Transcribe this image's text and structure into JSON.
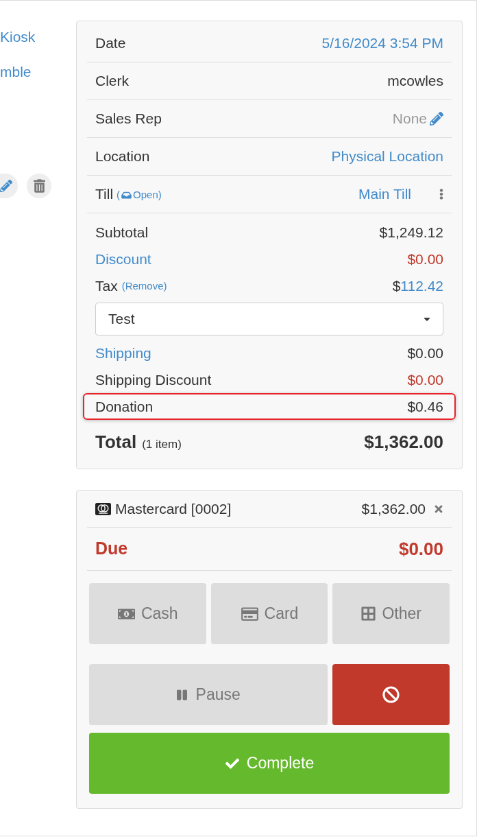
{
  "sidebar": {
    "links": [
      {
        "label": "Kiosk"
      },
      {
        "label": "mble"
      }
    ],
    "actions": [
      {
        "kind": "edit"
      },
      {
        "kind": "delete"
      }
    ]
  },
  "details": [
    {
      "label": "Date",
      "value": "5/16/2024 3:54 PM",
      "kind": "link"
    },
    {
      "label": "Clerk",
      "value": "mcowles",
      "kind": "text"
    },
    {
      "label": "Sales Rep",
      "value": "None",
      "kind": "empty_editable"
    },
    {
      "label": "Location",
      "value": "Physical Location",
      "kind": "link"
    },
    {
      "label": "Till",
      "status": {
        "open": "(",
        "text": "Open",
        "close": ")"
      },
      "value": "Main Till",
      "kind": "till"
    }
  ],
  "summary": {
    "lines": [
      {
        "kind": "line",
        "label": "Subtotal",
        "link": false,
        "deduction": false,
        "highlighted": false,
        "value": "$1,249.12"
      },
      {
        "kind": "line",
        "label": "Discount",
        "link": true,
        "deduction": true,
        "highlighted": false,
        "value": "$0.00"
      },
      {
        "kind": "tax",
        "label": "Tax",
        "action": "(Remove)",
        "currency": "$",
        "value": "112.42"
      },
      {
        "kind": "select",
        "value": "Test"
      },
      {
        "kind": "line",
        "label": "Shipping",
        "link": true,
        "deduction": false,
        "highlighted": false,
        "value": "$0.00"
      },
      {
        "kind": "line",
        "label": "Shipping Discount",
        "link": false,
        "deduction": true,
        "highlighted": false,
        "value": "$0.00"
      },
      {
        "kind": "line",
        "label": "Donation",
        "link": false,
        "deduction": false,
        "highlighted": true,
        "value": "$0.46"
      }
    ],
    "total": {
      "label": "Total",
      "count": "(1 item)",
      "value": "$1,362.00"
    }
  },
  "payments": [
    {
      "method": "Mastercard [0002]",
      "amount": "$1,362.00"
    }
  ],
  "due": {
    "label": "Due",
    "value": "$0.00"
  },
  "tender_buttons": [
    {
      "kind": "cash",
      "label": "Cash"
    },
    {
      "kind": "card",
      "label": "Card"
    },
    {
      "kind": "other",
      "label": "Other"
    }
  ],
  "actions": [
    {
      "kind": "pause",
      "label": "Pause"
    },
    {
      "kind": "void"
    },
    {
      "kind": "complete",
      "label": "Complete"
    }
  ]
}
